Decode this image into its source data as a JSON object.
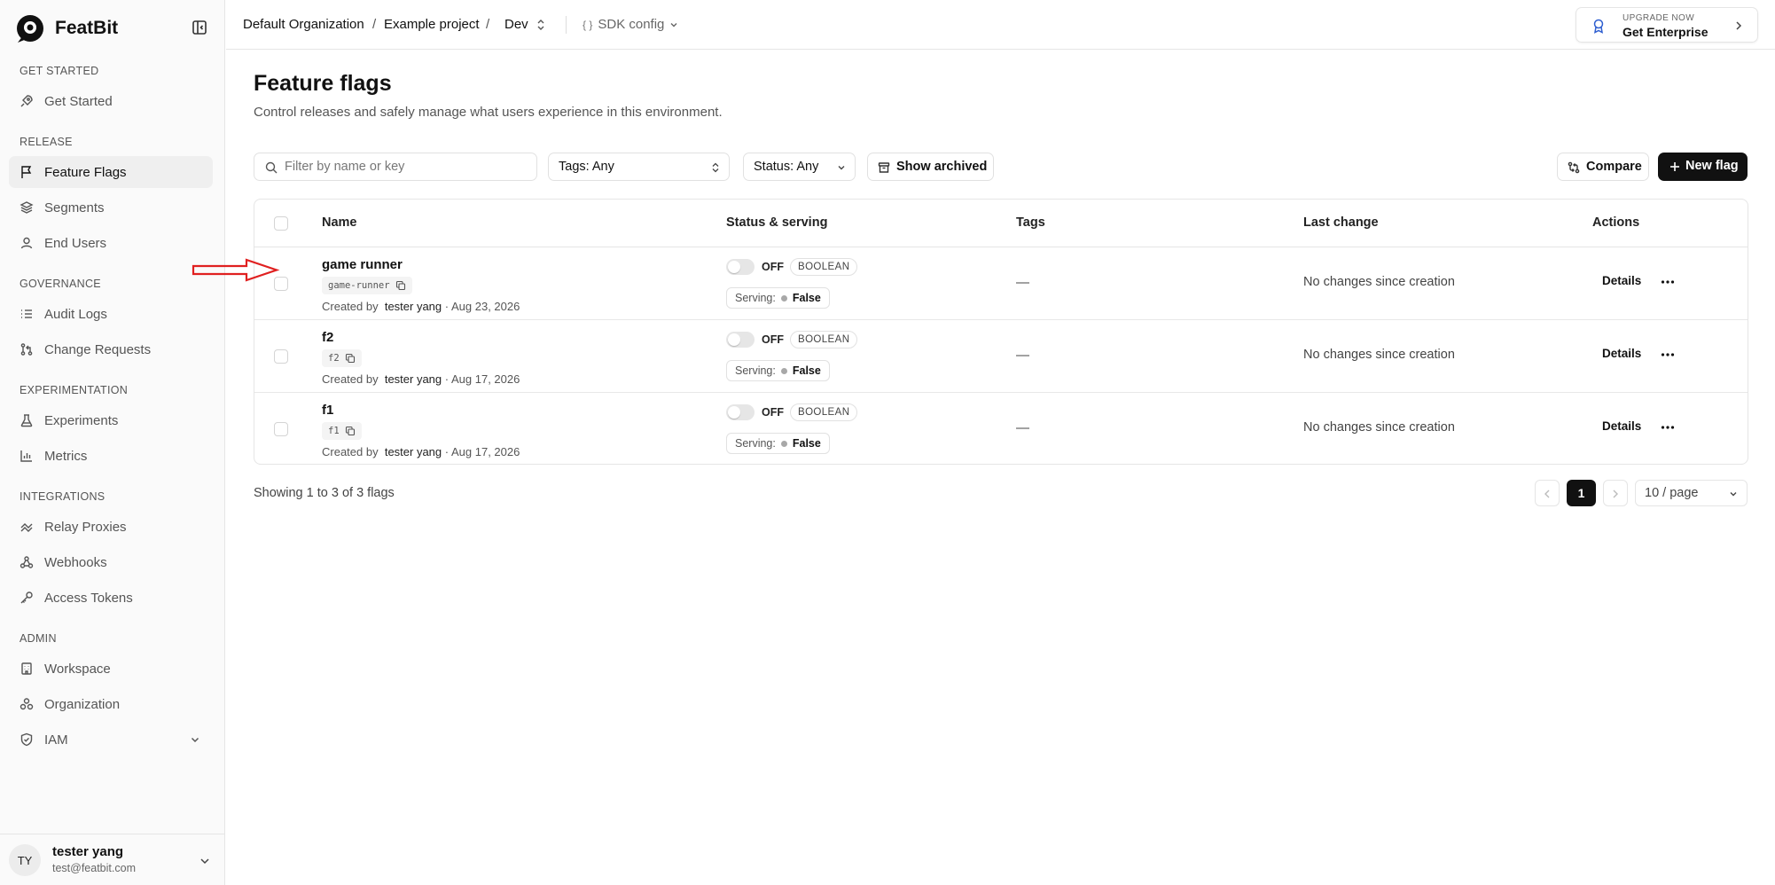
{
  "app": {
    "name": "FeatBit"
  },
  "sidebar": {
    "sections": [
      {
        "title": "GET STARTED",
        "items": [
          {
            "label": "Get Started",
            "icon": "rocket-icon"
          }
        ]
      },
      {
        "title": "RELEASE",
        "items": [
          {
            "label": "Feature Flags",
            "icon": "flag-icon",
            "active": true
          },
          {
            "label": "Segments",
            "icon": "layers-icon"
          },
          {
            "label": "End Users",
            "icon": "user-icon"
          }
        ]
      },
      {
        "title": "GOVERNANCE",
        "items": [
          {
            "label": "Audit Logs",
            "icon": "list-icon"
          },
          {
            "label": "Change Requests",
            "icon": "git-pull-request-icon"
          }
        ]
      },
      {
        "title": "EXPERIMENTATION",
        "items": [
          {
            "label": "Experiments",
            "icon": "flask-icon"
          },
          {
            "label": "Metrics",
            "icon": "bar-chart-icon"
          }
        ]
      },
      {
        "title": "INTEGRATIONS",
        "items": [
          {
            "label": "Relay Proxies",
            "icon": "relay-icon"
          },
          {
            "label": "Webhooks",
            "icon": "webhook-icon"
          },
          {
            "label": "Access Tokens",
            "icon": "key-icon"
          }
        ]
      },
      {
        "title": "ADMIN",
        "items": [
          {
            "label": "Workspace",
            "icon": "building-icon"
          },
          {
            "label": "Organization",
            "icon": "organization-icon"
          },
          {
            "label": "IAM",
            "icon": "shield-icon"
          }
        ]
      }
    ],
    "user": {
      "initials": "TY",
      "name": "tester yang",
      "email": "test@featbit.com"
    }
  },
  "topbar": {
    "org": "Default Organization",
    "project": "Example project",
    "env": "Dev",
    "sdk_config": "SDK config",
    "sep": "/",
    "upgrade_top": "UPGRADE NOW",
    "upgrade_main": "Get Enterprise"
  },
  "page": {
    "title": "Feature flags",
    "subtitle": "Control releases and safely manage what users experience in this environment."
  },
  "filters": {
    "search_placeholder": "Filter by name or key",
    "tags": "Tags: Any",
    "status": "Status: Any",
    "show_archived": "Show archived",
    "compare": "Compare",
    "new_flag": "New flag"
  },
  "table": {
    "headers": {
      "name": "Name",
      "status": "Status & serving",
      "tags": "Tags",
      "last_change": "Last change",
      "actions": "Actions"
    },
    "rows": [
      {
        "name": "game runner",
        "key": "game-runner",
        "created_by_label": "Created by",
        "creator": "tester yang",
        "date": "· Aug 23, 2026",
        "state": "OFF",
        "type": "BOOLEAN",
        "serving_label": "Serving:",
        "serving": "False",
        "tags": "—",
        "last_change": "No changes since creation",
        "action": "Details"
      },
      {
        "name": "f2",
        "key": "f2",
        "created_by_label": "Created by",
        "creator": "tester yang",
        "date": "· Aug 17, 2026",
        "state": "OFF",
        "type": "BOOLEAN",
        "serving_label": "Serving:",
        "serving": "False",
        "tags": "—",
        "last_change": "No changes since creation",
        "action": "Details"
      },
      {
        "name": "f1",
        "key": "f1",
        "created_by_label": "Created by",
        "creator": "tester yang",
        "date": "· Aug 17, 2026",
        "state": "OFF",
        "type": "BOOLEAN",
        "serving_label": "Serving:",
        "serving": "False",
        "tags": "—",
        "last_change": "No changes since creation",
        "action": "Details"
      }
    ]
  },
  "pagination": {
    "summary": "Showing 1 to 3 of 3 flags",
    "current": "1",
    "page_size": "10 / page"
  },
  "colors": {
    "accent": "#111111",
    "annotation_arrow": "#e02020",
    "upgrade_icon": "#2f5fd0"
  }
}
